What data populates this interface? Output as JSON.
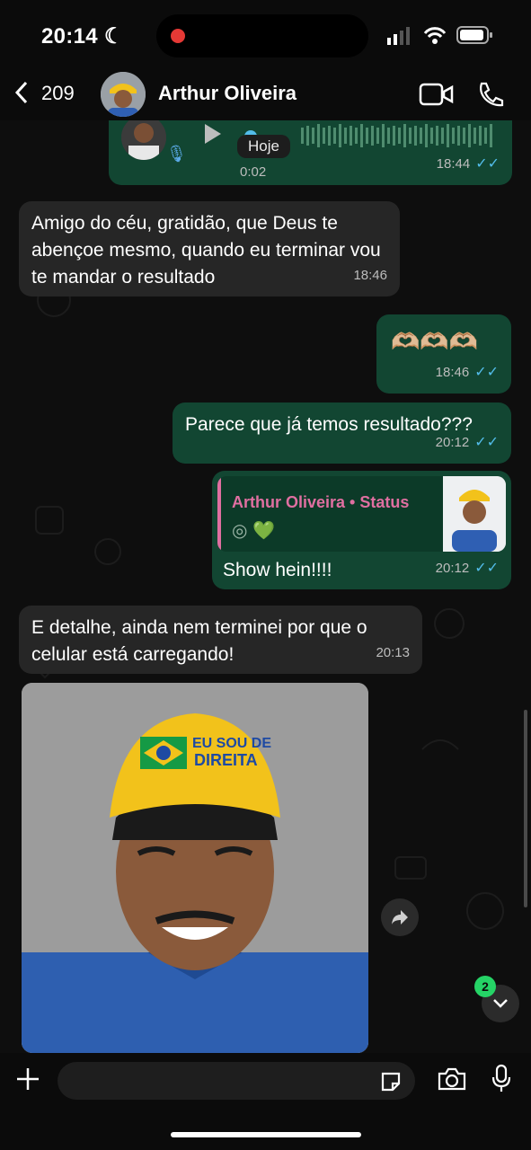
{
  "status_bar": {
    "time": "20:14"
  },
  "header": {
    "back_count": "209",
    "contact_name": "Arthur Oliveira"
  },
  "voice_message": {
    "duration": "0:02",
    "time": "18:44"
  },
  "date_chip": "Hoje",
  "messages": [
    {
      "type": "in",
      "text": "Amigo do céu, gratidão, que Deus te abençoe mesmo, quando eu terminar vou te mandar o resultado",
      "time": "18:46"
    },
    {
      "type": "out",
      "text": "🫶🏼🫶🏼🫶🏼",
      "time": "18:46"
    },
    {
      "type": "out",
      "text": "Parece que já temos resultado???",
      "time": "20:12"
    },
    {
      "type": "out",
      "reply_title": "Arthur Oliveira • Status",
      "reply_icons": "◎ 💚",
      "text": "Show hein!!!!",
      "time": "20:12"
    },
    {
      "type": "in",
      "text": "E detalhe, ainda nem terminei por que o celular está carregando!",
      "time": "20:13"
    }
  ],
  "image_message": {
    "cap_text": "EU SOU DE DIREITA"
  },
  "unread_badge": "2",
  "colors": {
    "outgoing": "#124632",
    "incoming": "#262626",
    "accent": "#25d366",
    "ticks": "#53bdeb"
  }
}
